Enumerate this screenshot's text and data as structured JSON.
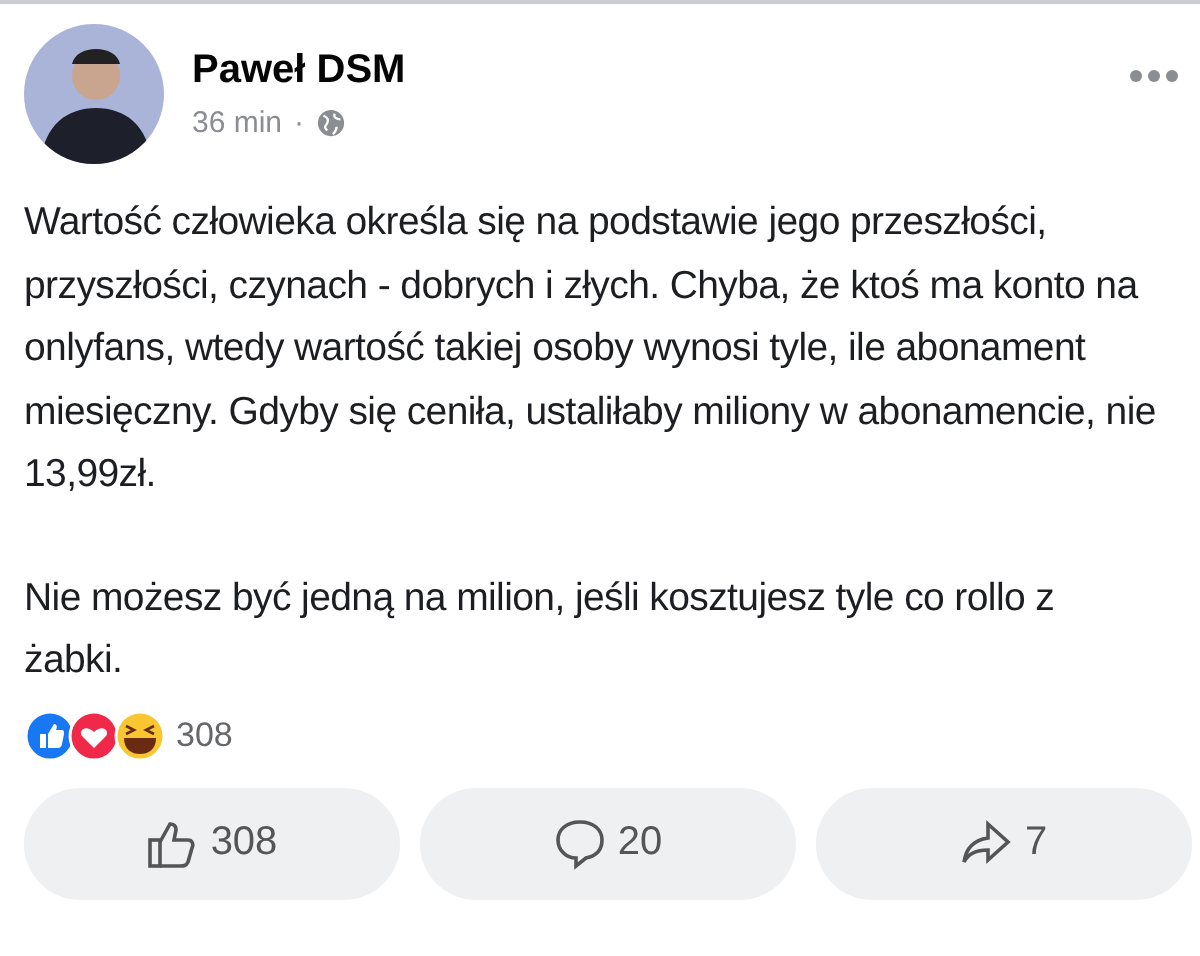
{
  "post": {
    "author": "Paweł DSM",
    "time": "36 min",
    "separator": "·",
    "paragraphs": [
      "Wartość człowieka określa się na podstawie jego przeszłości, przyszłości, czynach - dobrych i złych. Chyba, że ktoś ma konto na onlyfans, wtedy wartość takiej osoby wynosi tyle, ile abonament miesięczny. Gdyby się ceniła, ustaliłaby miliony w abonamencie, nie 13,99zł.",
      "Nie możesz być jedną na milion, jeśli kosztujesz tyle co rollo z żabki."
    ],
    "reaction_count": "308"
  },
  "actions": [
    {
      "kind": "like",
      "count": "308"
    },
    {
      "kind": "comment",
      "count": "20"
    },
    {
      "kind": "share",
      "count": "7"
    }
  ]
}
